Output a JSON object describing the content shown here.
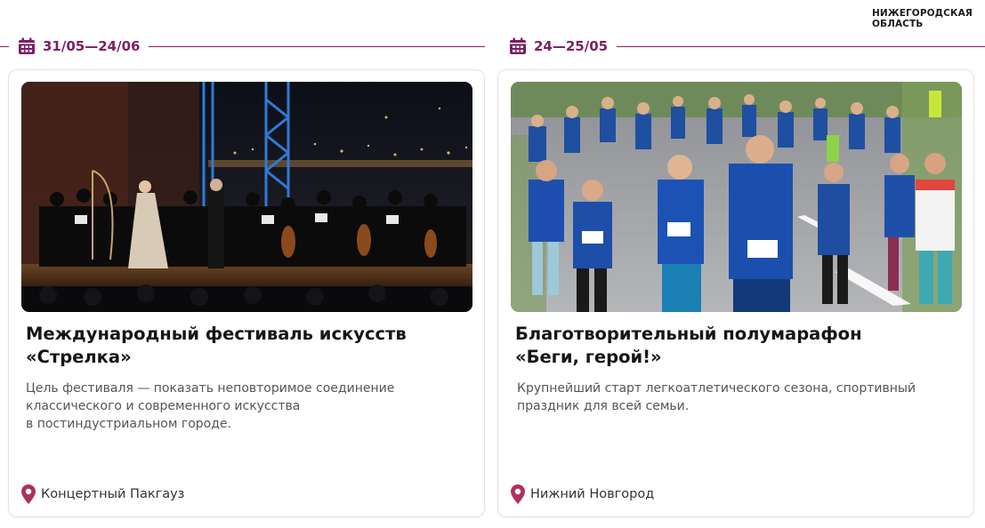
{
  "region": {
    "line1": "НИЖЕГОРОДСКАЯ",
    "line2": "ОБЛАСТЬ"
  },
  "colors": {
    "accent": "#7b1f66",
    "pin": "#b0305e"
  },
  "events": [
    {
      "date": "31/05—24/06",
      "title_line1": "Международный фестиваль искусств",
      "title_line2": "«Стрелка»",
      "desc_line1": "Цель фестиваля — показать неповторимое соединение",
      "desc_line2": "классического и современного искусства",
      "desc_line3": "в постиндустриальном городе.",
      "location": "Концертный Пакгауз",
      "image": "orchestra-concert-photo"
    },
    {
      "date": "24—25/05",
      "title_line1": "Благотворительный полумарафон",
      "title_line2": "«Беги, герой!»",
      "desc_line1": "Крупнейший старт легкоатлетического сезона, спортивный",
      "desc_line2": "праздник для всей семьи.",
      "location": "Нижний Новгород",
      "image": "half-marathon-runners-photo"
    }
  ]
}
